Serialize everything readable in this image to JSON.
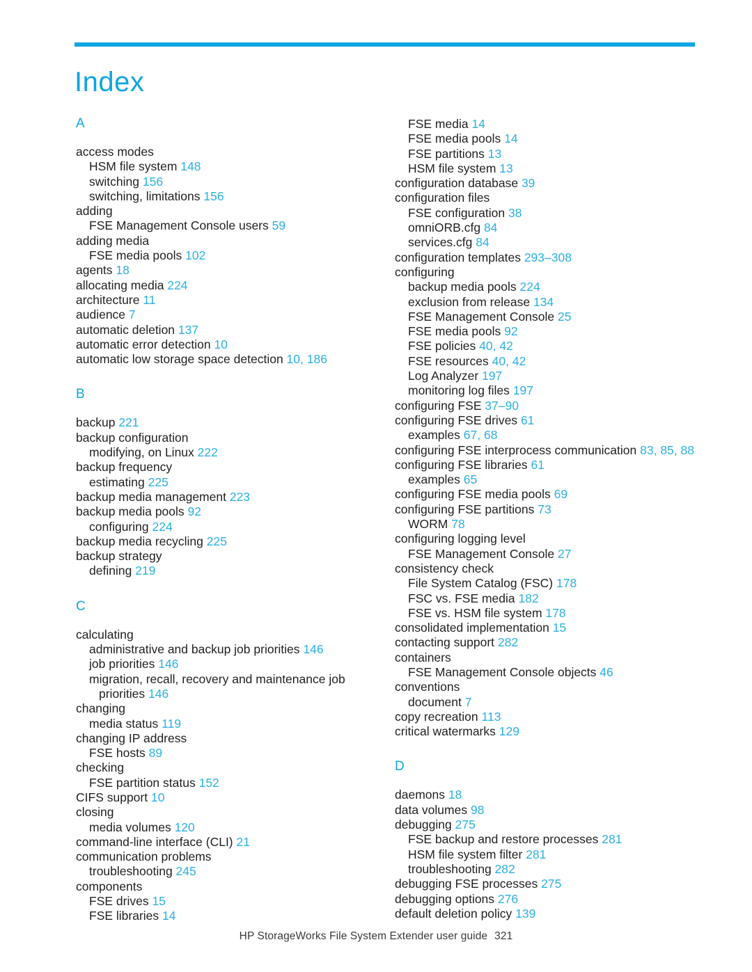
{
  "document": {
    "title": "Index",
    "accent_color": "#0ea5e0",
    "page_number_color": "#2ab0e4",
    "text_color": "#221f1f"
  },
  "footer": {
    "guide_title": "HP StorageWorks File System Extender user guide",
    "page_number": "321"
  },
  "columns": [
    {
      "id": "left",
      "sections": [
        {
          "letter": "A",
          "entries": [
            {
              "level": 0,
              "text": "access modes",
              "pages": ""
            },
            {
              "level": 1,
              "text": "HSM file system",
              "pages": "148"
            },
            {
              "level": 1,
              "text": "switching",
              "pages": "156"
            },
            {
              "level": 1,
              "text": "switching, limitations",
              "pages": "156"
            },
            {
              "level": 0,
              "text": "adding",
              "pages": ""
            },
            {
              "level": 1,
              "text": "FSE Management Console users",
              "pages": "59"
            },
            {
              "level": 0,
              "text": "adding media",
              "pages": ""
            },
            {
              "level": 1,
              "text": "FSE media pools",
              "pages": "102"
            },
            {
              "level": 0,
              "text": "agents",
              "pages": "18"
            },
            {
              "level": 0,
              "text": "allocating media",
              "pages": "224"
            },
            {
              "level": 0,
              "text": "architecture",
              "pages": "11"
            },
            {
              "level": 0,
              "text": "audience",
              "pages": "7"
            },
            {
              "level": 0,
              "text": "automatic deletion",
              "pages": "137"
            },
            {
              "level": 0,
              "text": "automatic error detection",
              "pages": "10"
            },
            {
              "level": 0,
              "text": "automatic low storage space detection",
              "pages": "10, 186"
            }
          ]
        },
        {
          "letter": "B",
          "entries": [
            {
              "level": 0,
              "text": "backup",
              "pages": "221"
            },
            {
              "level": 0,
              "text": "backup configuration",
              "pages": ""
            },
            {
              "level": 1,
              "text": "modifying, on Linux",
              "pages": "222"
            },
            {
              "level": 0,
              "text": "backup frequency",
              "pages": ""
            },
            {
              "level": 1,
              "text": "estimating",
              "pages": "225"
            },
            {
              "level": 0,
              "text": "backup media management",
              "pages": "223"
            },
            {
              "level": 0,
              "text": "backup media pools",
              "pages": "92"
            },
            {
              "level": 1,
              "text": "configuring",
              "pages": "224"
            },
            {
              "level": 0,
              "text": "backup media recycling",
              "pages": "225"
            },
            {
              "level": 0,
              "text": "backup strategy",
              "pages": ""
            },
            {
              "level": 1,
              "text": "defining",
              "pages": "219"
            }
          ]
        },
        {
          "letter": "C",
          "entries": [
            {
              "level": 0,
              "text": "calculating",
              "pages": ""
            },
            {
              "level": 1,
              "text": "administrative and backup job priorities",
              "pages": "146"
            },
            {
              "level": 1,
              "text": "job priorities",
              "pages": "146"
            },
            {
              "level": 1,
              "wrap": true,
              "text": "migration, recall, recovery and maintenance job priorities",
              "pages": "146"
            },
            {
              "level": 0,
              "text": "changing",
              "pages": ""
            },
            {
              "level": 1,
              "text": "media status",
              "pages": "119"
            },
            {
              "level": 0,
              "text": "changing IP address",
              "pages": ""
            },
            {
              "level": 1,
              "text": "FSE hosts",
              "pages": "89"
            },
            {
              "level": 0,
              "text": "checking",
              "pages": ""
            },
            {
              "level": 1,
              "text": "FSE partition status",
              "pages": "152"
            },
            {
              "level": 0,
              "text": "CIFS support",
              "pages": "10"
            },
            {
              "level": 0,
              "text": "closing",
              "pages": ""
            },
            {
              "level": 1,
              "text": "media volumes",
              "pages": "120"
            },
            {
              "level": 0,
              "text": "command-line interface (CLI)",
              "pages": "21"
            },
            {
              "level": 0,
              "text": "communication problems",
              "pages": ""
            },
            {
              "level": 1,
              "text": "troubleshooting",
              "pages": "245"
            },
            {
              "level": 0,
              "text": "components",
              "pages": ""
            },
            {
              "level": 1,
              "text": "FSE drives",
              "pages": "15"
            },
            {
              "level": 1,
              "text": "FSE libraries",
              "pages": "14"
            }
          ]
        }
      ]
    },
    {
      "id": "right",
      "sections": [
        {
          "letter": "",
          "entries": [
            {
              "level": 1,
              "text": "FSE media",
              "pages": "14"
            },
            {
              "level": 1,
              "text": "FSE media pools",
              "pages": "14"
            },
            {
              "level": 1,
              "text": "FSE partitions",
              "pages": "13"
            },
            {
              "level": 1,
              "text": "HSM file system",
              "pages": "13"
            },
            {
              "level": 0,
              "text": "configuration database",
              "pages": "39"
            },
            {
              "level": 0,
              "text": "configuration files",
              "pages": ""
            },
            {
              "level": 1,
              "text": "FSE configuration",
              "pages": "38"
            },
            {
              "level": 1,
              "text": "omniORB.cfg",
              "pages": "84"
            },
            {
              "level": 1,
              "text": "services.cfg",
              "pages": "84"
            },
            {
              "level": 0,
              "text": "configuration templates",
              "pages": "293–308"
            },
            {
              "level": 0,
              "text": "configuring",
              "pages": ""
            },
            {
              "level": 1,
              "text": "backup media pools",
              "pages": "224"
            },
            {
              "level": 1,
              "text": "exclusion from release",
              "pages": "134"
            },
            {
              "level": 1,
              "text": "FSE Management Console",
              "pages": "25"
            },
            {
              "level": 1,
              "text": "FSE media pools",
              "pages": "92"
            },
            {
              "level": 1,
              "text": "FSE policies",
              "pages": "40, 42"
            },
            {
              "level": 1,
              "text": "FSE resources",
              "pages": "40, 42"
            },
            {
              "level": 1,
              "text": "Log Analyzer",
              "pages": "197"
            },
            {
              "level": 1,
              "text": "monitoring log files",
              "pages": "197"
            },
            {
              "level": 0,
              "text": "configuring FSE",
              "pages": "37–90"
            },
            {
              "level": 0,
              "text": "configuring FSE drives",
              "pages": "61"
            },
            {
              "level": 1,
              "text": "examples",
              "pages": "67, 68"
            },
            {
              "level": 0,
              "text": "configuring FSE interprocess communication",
              "pages": "83, 85, 88"
            },
            {
              "level": 0,
              "text": "configuring FSE libraries",
              "pages": "61"
            },
            {
              "level": 1,
              "text": "examples",
              "pages": "65"
            },
            {
              "level": 0,
              "text": "configuring FSE media pools",
              "pages": "69"
            },
            {
              "level": 0,
              "text": "configuring FSE partitions",
              "pages": "73"
            },
            {
              "level": 1,
              "text": "WORM",
              "pages": "78"
            },
            {
              "level": 0,
              "text": "configuring logging level",
              "pages": ""
            },
            {
              "level": 1,
              "text": "FSE Management Console",
              "pages": "27"
            },
            {
              "level": 0,
              "text": "consistency check",
              "pages": ""
            },
            {
              "level": 1,
              "text": "File System Catalog (FSC)",
              "pages": "178"
            },
            {
              "level": 1,
              "text": "FSC vs. FSE media",
              "pages": "182"
            },
            {
              "level": 1,
              "text": "FSE vs. HSM file system",
              "pages": "178"
            },
            {
              "level": 0,
              "text": "consolidated implementation",
              "pages": "15"
            },
            {
              "level": 0,
              "text": "contacting support",
              "pages": "282"
            },
            {
              "level": 0,
              "text": "containers",
              "pages": ""
            },
            {
              "level": 1,
              "text": "FSE Management Console objects",
              "pages": "46"
            },
            {
              "level": 0,
              "text": "conventions",
              "pages": ""
            },
            {
              "level": 1,
              "text": "document",
              "pages": "7"
            },
            {
              "level": 0,
              "text": "copy recreation",
              "pages": "113"
            },
            {
              "level": 0,
              "text": "critical watermarks",
              "pages": "129"
            }
          ]
        },
        {
          "letter": "D",
          "entries": [
            {
              "level": 0,
              "text": "daemons",
              "pages": "18"
            },
            {
              "level": 0,
              "text": "data volumes",
              "pages": "98"
            },
            {
              "level": 0,
              "text": "debugging",
              "pages": "275"
            },
            {
              "level": 1,
              "text": "FSE backup and restore processes",
              "pages": "281"
            },
            {
              "level": 1,
              "text": "HSM file system filter",
              "pages": "281"
            },
            {
              "level": 1,
              "text": "troubleshooting",
              "pages": "282"
            },
            {
              "level": 0,
              "text": "debugging FSE processes",
              "pages": "275"
            },
            {
              "level": 0,
              "text": "debugging options",
              "pages": "276"
            },
            {
              "level": 0,
              "text": "default deletion policy",
              "pages": "139"
            }
          ]
        }
      ]
    }
  ]
}
